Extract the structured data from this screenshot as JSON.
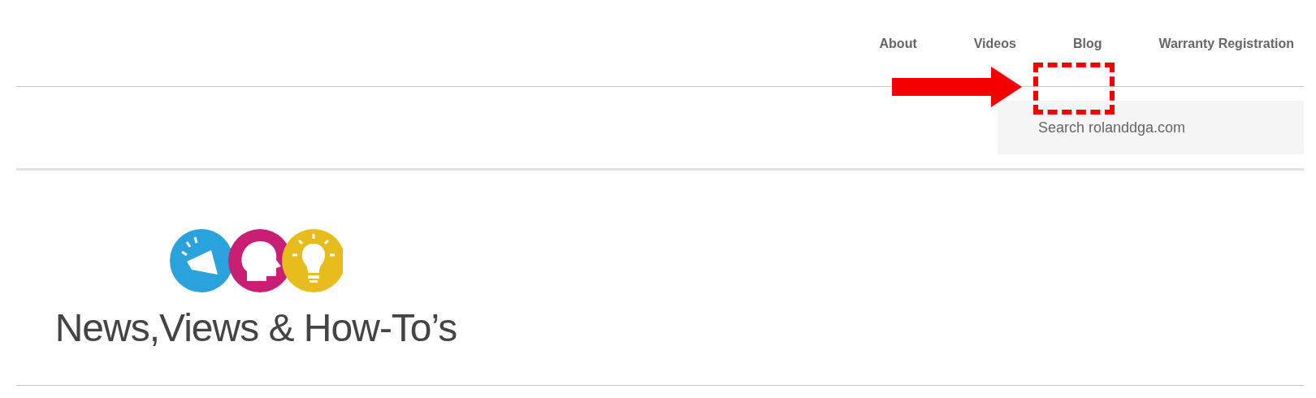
{
  "nav": {
    "links": [
      {
        "label": "About"
      },
      {
        "label": "Videos"
      },
      {
        "label": "Blog"
      },
      {
        "label": "Warranty Registration"
      }
    ]
  },
  "search": {
    "placeholder": "Search rolanddga.com"
  },
  "blog_header": {
    "title": "News,Views & How-To’s"
  }
}
